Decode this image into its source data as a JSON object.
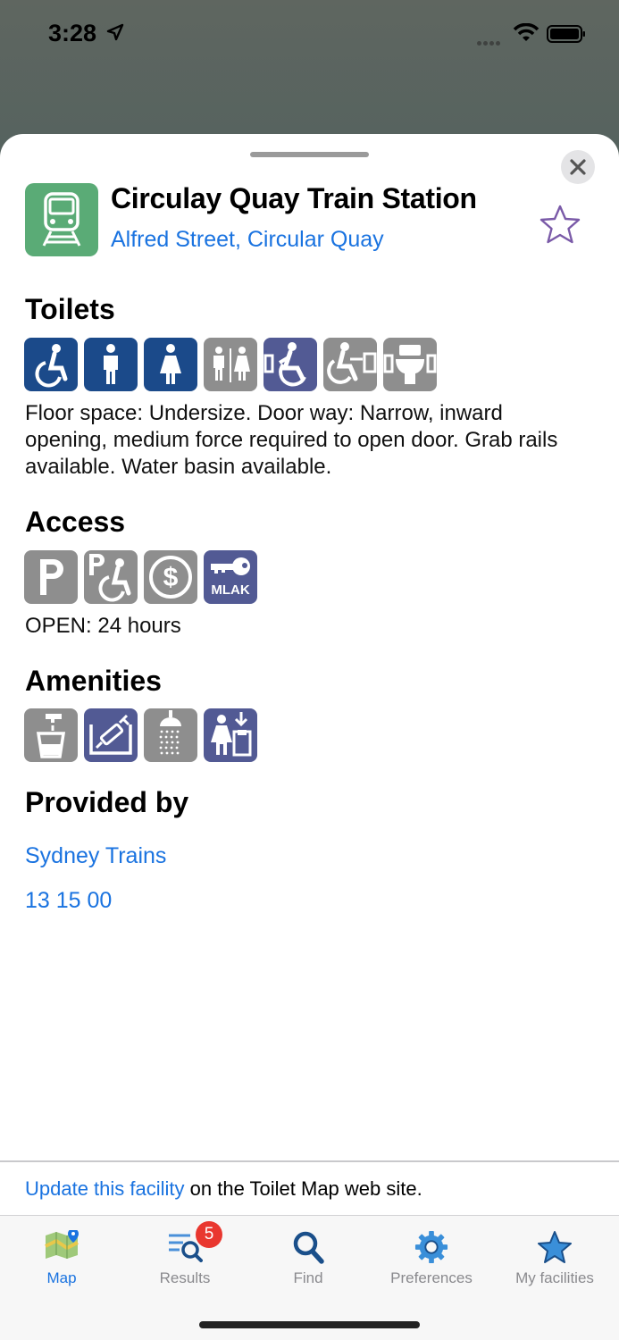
{
  "status_bar": {
    "time": "3:28"
  },
  "facility": {
    "title": "Circulay Quay Train Station",
    "address": "Alfred Street, Circular Quay",
    "icon": "train-icon",
    "favorite": false
  },
  "sections": {
    "toilets": {
      "title": "Toilets",
      "icons": [
        "accessible-toilet-icon",
        "male-toilet-icon",
        "female-toilet-icon",
        "unisex-toilet-icon",
        "left-transfer-icon",
        "right-transfer-icon",
        "ambulant-toilet-icon"
      ],
      "description": "Floor space: Undersize. Door way: Narrow, inward opening, medium force required to open door. Grab rails available. Water basin available."
    },
    "access": {
      "title": "Access",
      "icons": [
        "parking-icon",
        "accessible-parking-icon",
        "payment-icon",
        "mlak-key-icon"
      ],
      "mlak_label": "MLAK",
      "hours": "OPEN: 24 hours"
    },
    "amenities": {
      "title": "Amenities",
      "icons": [
        "drinking-water-icon",
        "sharps-disposal-icon",
        "shower-icon",
        "sanitary-disposal-icon"
      ]
    },
    "provider": {
      "title": "Provided by",
      "name": "Sydney Trains",
      "phone": "13 15 00"
    }
  },
  "footer": {
    "link_text": "Update this facility",
    "rest_text": " on the Toilet Map web site."
  },
  "tabbar": {
    "tabs": [
      {
        "label": "Map",
        "icon": "map-icon",
        "active": true
      },
      {
        "label": "Results",
        "icon": "results-icon",
        "badge": "5"
      },
      {
        "label": "Find",
        "icon": "search-icon"
      },
      {
        "label": "Preferences",
        "icon": "gear-icon"
      },
      {
        "label": "My facilities",
        "icon": "star-icon"
      }
    ]
  },
  "colors": {
    "link": "#1a73e0",
    "navy": "#1b4a8a",
    "grey": "#8e8e8e",
    "purple": "#525a94",
    "station_green": "#5aab76",
    "badge_red": "#e9372f"
  }
}
